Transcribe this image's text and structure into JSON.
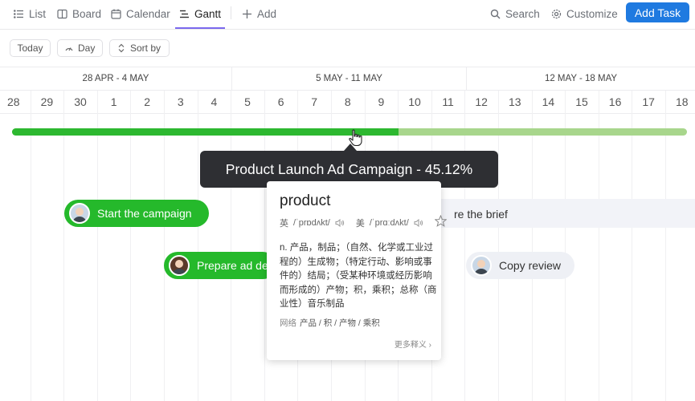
{
  "tabs": [
    {
      "label": "List",
      "icon": "list-icon"
    },
    {
      "label": "Board",
      "icon": "board-icon"
    },
    {
      "label": "Calendar",
      "icon": "calendar-icon"
    },
    {
      "label": "Gantt",
      "icon": "gantt-icon",
      "active": true
    },
    {
      "label": "Add",
      "icon": "plus-icon"
    }
  ],
  "header": {
    "search_label": "Search",
    "customize_label": "Customize",
    "add_task_label": "Add Task"
  },
  "toolbar": {
    "today_label": "Today",
    "day_label": "Day",
    "sort_label": "Sort by"
  },
  "timeline": {
    "weeks": [
      "28 APR - 4 MAY",
      "5 MAY - 11 MAY",
      "12 MAY - 18 MAY"
    ],
    "days": [
      "28",
      "29",
      "30",
      "1",
      "2",
      "3",
      "4",
      "5",
      "6",
      "7",
      "8",
      "9",
      "10",
      "11",
      "12",
      "13",
      "14",
      "15",
      "16",
      "17",
      "18"
    ]
  },
  "project": {
    "progress": 0.4512,
    "tooltip": "Product Launch Ad Campaign - 45.12%"
  },
  "tasks": [
    {
      "label": "Start the campaign"
    },
    {
      "label": "Prepare ad de"
    },
    {
      "label": "re the brief"
    },
    {
      "label": "Copy review"
    }
  ],
  "dictionary": {
    "word": "product",
    "uk_label": "英",
    "uk_phonetic": "/ˈprɒdʌkt/",
    "us_label": "美",
    "us_phonetic": "/ˈprɑːdʌkt/",
    "definition": "n. 产品，制品；（自然、化学或工业过程的）生成物；（特定行动、影响或事件的）结局；（受某种环境或经历影响而形成的）产物；积，乘积；总称（商业性）音乐制品",
    "net_label": "网络",
    "net_terms": "产品 / 积 / 产物 / 乘积",
    "more_label": "更多释义 ›"
  },
  "colors": {
    "accent": "#1f7ae0",
    "progress_done": "#2db830",
    "progress_rest": "#a8d68c",
    "task_green": "#25b92b",
    "tooltip_bg": "#2e2f33"
  }
}
